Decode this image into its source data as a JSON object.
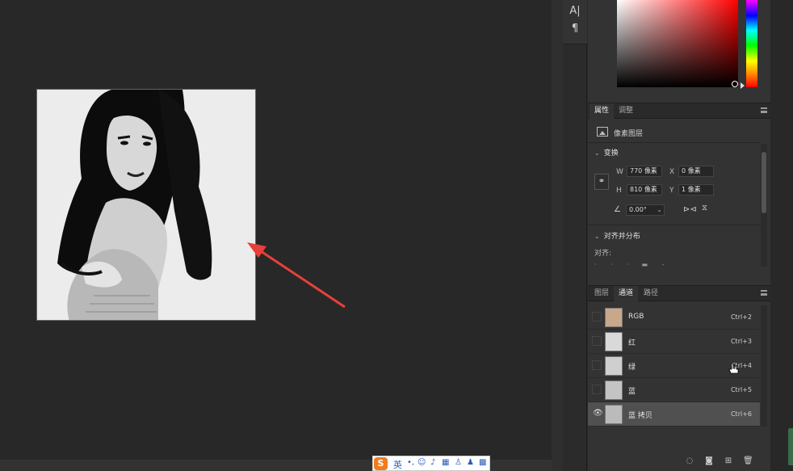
{
  "toolstrip": {
    "items": [
      {
        "name": "character-tool",
        "glyph": "A|"
      },
      {
        "name": "paragraph-tool",
        "glyph": "¶"
      }
    ]
  },
  "properties_panel": {
    "tabs": [
      {
        "label": "属性",
        "active": true
      },
      {
        "label": "调整",
        "active": false
      }
    ],
    "layer_type": "像素图层",
    "transform": {
      "title": "变换",
      "w_label": "W",
      "w_value": "770 像素",
      "h_label": "H",
      "h_value": "810 像素",
      "x_label": "X",
      "x_value": "0 像素",
      "y_label": "Y",
      "y_value": "1 像素",
      "angle_value": "0.00°"
    },
    "align": {
      "title": "对齐并分布",
      "subtitle": "对齐:"
    }
  },
  "channels_panel": {
    "tabs": [
      {
        "label": "图层",
        "active": false
      },
      {
        "label": "通道",
        "active": true
      },
      {
        "label": "路径",
        "active": false
      }
    ],
    "channels": [
      {
        "name": "RGB",
        "shortcut": "Ctrl+2",
        "visible": false,
        "selected": false
      },
      {
        "name": "红",
        "shortcut": "Ctrl+3",
        "visible": false,
        "selected": false
      },
      {
        "name": "绿",
        "shortcut": "Ctrl+4",
        "visible": false,
        "selected": false
      },
      {
        "name": "蓝",
        "shortcut": "Ctrl+5",
        "visible": false,
        "selected": false
      },
      {
        "name": "蓝 拷贝",
        "shortcut": "Ctrl+6",
        "visible": true,
        "selected": true
      }
    ]
  },
  "ime_toolbar": {
    "logo": "S",
    "lang": "英"
  },
  "colors": {
    "app_bg": "#282828",
    "panel_bg": "#333333",
    "selected_row": "#505050",
    "arrow": "#e8403a",
    "ime_accent": "#f07c1e"
  }
}
